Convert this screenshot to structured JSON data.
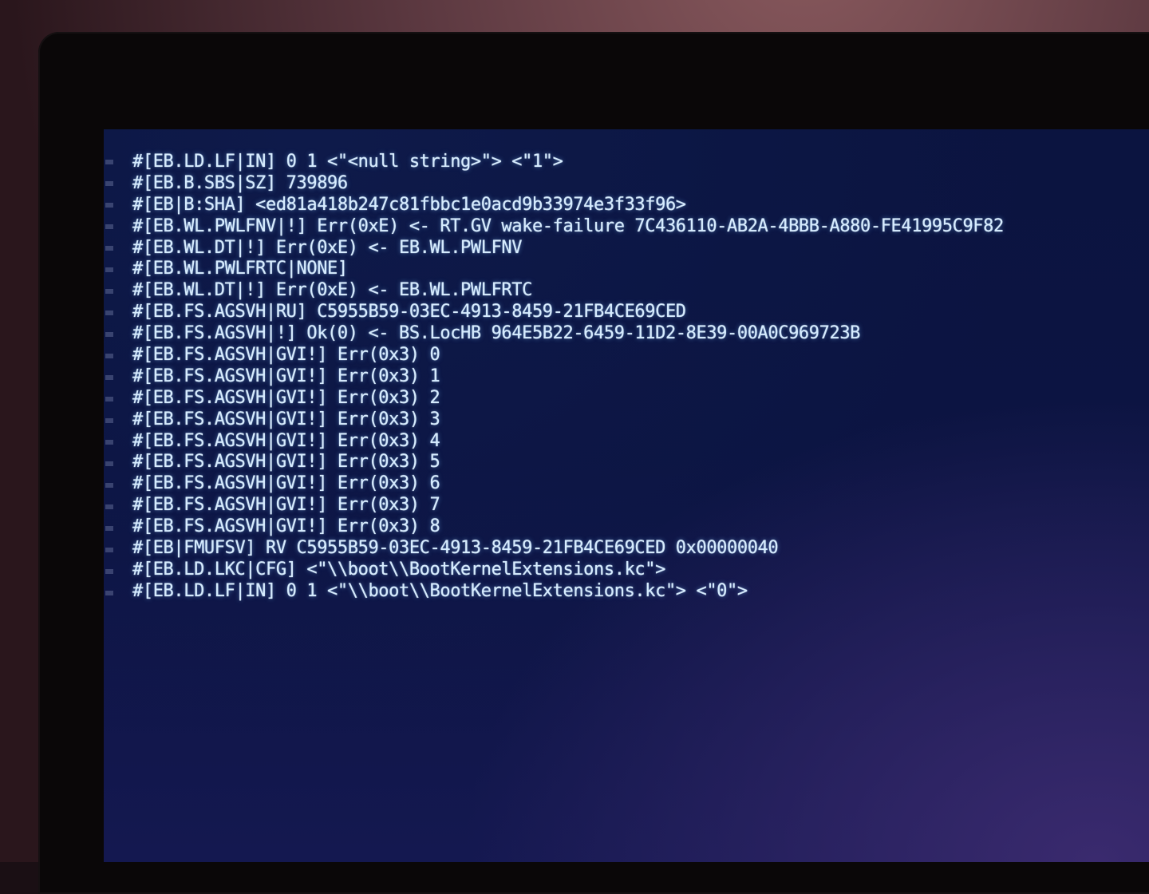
{
  "console": {
    "lines": [
      "#[EB.LD.LF|IN] 0 1 <\"<null string>\"> <\"1\">",
      "#[EB.B.SBS|SZ] 739896",
      "#[EB|B:SHA] <ed81a418b247c81fbbc1e0acd9b33974e3f33f96>",
      "#[EB.WL.PWLFNV|!] Err(0xE) <- RT.GV wake-failure 7C436110-AB2A-4BBB-A880-FE41995C9F82",
      "#[EB.WL.DT|!] Err(0xE) <- EB.WL.PWLFNV",
      "#[EB.WL.PWLFRTC|NONE]",
      "#[EB.WL.DT|!] Err(0xE) <- EB.WL.PWLFRTC",
      "#[EB.FS.AGSVH|RU] C5955B59-03EC-4913-8459-21FB4CE69CED",
      "#[EB.FS.AGSVH|!] Ok(0) <- BS.LocHB 964E5B22-6459-11D2-8E39-00A0C969723B",
      "#[EB.FS.AGSVH|GVI!] Err(0x3) 0",
      "#[EB.FS.AGSVH|GVI!] Err(0x3) 1",
      "#[EB.FS.AGSVH|GVI!] Err(0x3) 2",
      "#[EB.FS.AGSVH|GVI!] Err(0x3) 3",
      "#[EB.FS.AGSVH|GVI!] Err(0x3) 4",
      "#[EB.FS.AGSVH|GVI!] Err(0x3) 5",
      "#[EB.FS.AGSVH|GVI!] Err(0x3) 6",
      "#[EB.FS.AGSVH|GVI!] Err(0x3) 7",
      "#[EB.FS.AGSVH|GVI!] Err(0x3) 8",
      "#[EB|FMUFSV] RV C5955B59-03EC-4913-8459-21FB4CE69CED 0x00000040",
      "#[EB.LD.LKC|CFG] <\"\\\\boot\\\\BootKernelExtensions.kc\">",
      "#[EB.LD.LF|IN] 0 1 <\"\\\\boot\\\\BootKernelExtensions.kc\"> <\"0\">"
    ]
  },
  "colors": {
    "text": "#d6ecff",
    "screen_background": "#0c1442"
  }
}
